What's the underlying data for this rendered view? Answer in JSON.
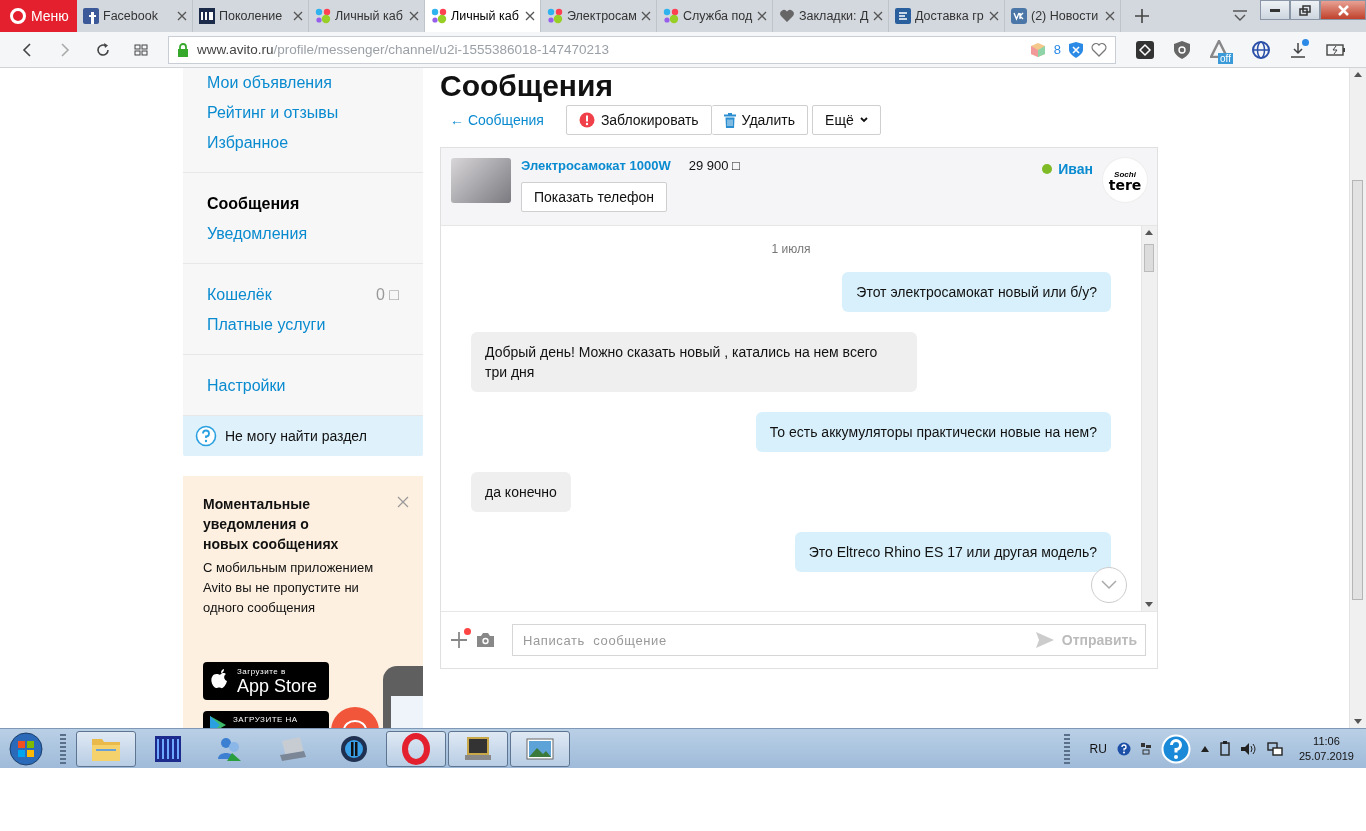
{
  "browser": {
    "menu_label": "Меню",
    "tabs": [
      {
        "title": "Facebook",
        "kind": "fb",
        "selected": false
      },
      {
        "title": "Поколение",
        "kind": "hd",
        "selected": false
      },
      {
        "title": "Личный каб",
        "kind": "dots",
        "selected": false
      },
      {
        "title": "Личный каб",
        "kind": "dots",
        "selected": true
      },
      {
        "title": "Электросам",
        "kind": "dots",
        "selected": false
      },
      {
        "title": "Служба под",
        "kind": "dots",
        "selected": false
      },
      {
        "title": "Закладки: Д",
        "kind": "heart",
        "selected": false
      },
      {
        "title": "Доставка гр",
        "kind": "e",
        "selected": false
      },
      {
        "title": "(2) Новости",
        "kind": "vk",
        "selected": false
      }
    ],
    "address": {
      "host": "www.avito.ru",
      "path": "/profile/messenger/channel/u2i-1555386018-147470213"
    },
    "extension_count": "8",
    "vpn_status": "off",
    "download_unread": true
  },
  "sidebar": {
    "groups": [
      {
        "items": [
          {
            "label": "Мои объявления",
            "selected": false
          },
          {
            "label": "Рейтинг и отзывы",
            "selected": false
          },
          {
            "label": "Избранное",
            "selected": false
          }
        ]
      },
      {
        "items": [
          {
            "label": "Сообщения",
            "selected": true
          },
          {
            "label": "Уведомления",
            "selected": false
          }
        ]
      },
      {
        "items": [
          {
            "label": "Кошелёк",
            "value": "0 □",
            "selected": false
          },
          {
            "label": "Платные услуги",
            "selected": false
          }
        ]
      },
      {
        "items": [
          {
            "label": "Настройки",
            "selected": false
          }
        ]
      }
    ],
    "help": "Не могу найти раздел"
  },
  "promo": {
    "title": "Моментальные уведомления о новых сообщениях",
    "text": "С мобильным приложением Avito вы не пропустите ни одного сообщения",
    "app_store": {
      "caption": "Загрузите в",
      "name": "App Store"
    },
    "google_play": {
      "caption": "ЗАГРУЗИТЕ НА"
    }
  },
  "page_title": "Сообщения",
  "toolbar": {
    "back": "← Сообщения",
    "buttons": [
      {
        "label": "Заблокировать",
        "kind": "block"
      },
      {
        "label": "Удалить",
        "kind": "delete"
      },
      {
        "label": "Ещё",
        "kind": "more"
      }
    ]
  },
  "listing": {
    "title": "Электросамокат 1000W",
    "price": "29 900 □",
    "phone_button": "Показать телефон",
    "seller": "Иван",
    "online": true,
    "logo": {
      "top": "Sochi",
      "bottom": "tere"
    }
  },
  "chat": {
    "date": "1 июля",
    "messages": [
      {
        "text": "Этот электросамокат новый или б/у?",
        "outgoing": true
      },
      {
        "text": "Добрый день! Можно сказать новый , катались на нем всего три дня",
        "outgoing": false
      },
      {
        "text": "То есть аккумуляторы практически новые на нем?",
        "outgoing": true
      },
      {
        "text": "да конечно",
        "outgoing": false
      },
      {
        "text": "Это Eltreco Rhino ES 17 или другая модель?",
        "outgoing": true
      }
    ],
    "attach_unread": true,
    "input": {
      "placeholder": "Написать  сообщение",
      "send": "Отправить",
      "send_disabled": true
    }
  },
  "taskbar": {
    "apps": [
      {
        "kind": "folder",
        "open": true
      },
      {
        "kind": "server",
        "open": false
      },
      {
        "kind": "users",
        "open": false
      },
      {
        "kind": "scanner",
        "open": false
      },
      {
        "kind": "disc",
        "open": false
      },
      {
        "kind": "ring",
        "open": true
      },
      {
        "kind": "laptop",
        "open": true
      },
      {
        "kind": "picture",
        "open": true
      }
    ],
    "language": "RU",
    "time": "11:06",
    "date": "25.07.2019"
  }
}
